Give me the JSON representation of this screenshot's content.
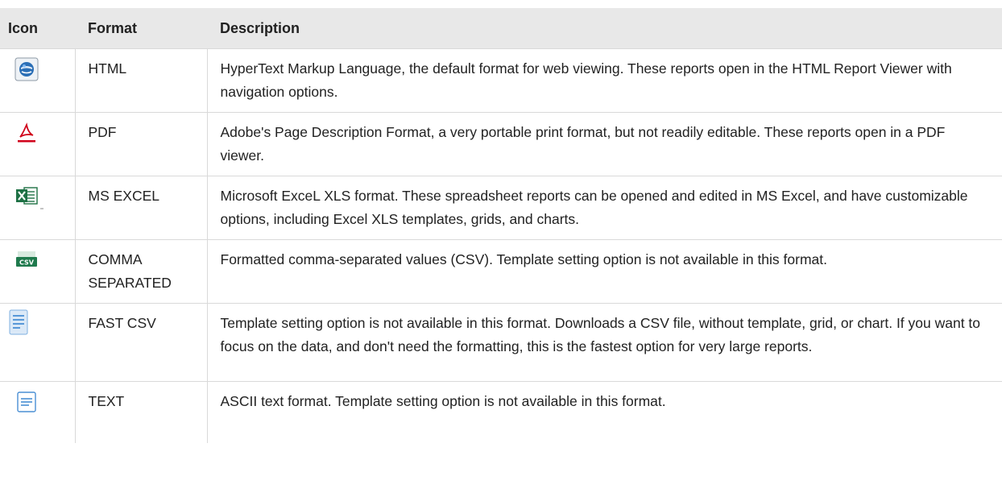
{
  "table": {
    "headers": {
      "icon": "Icon",
      "format": "Format",
      "description": "Description"
    },
    "rows": [
      {
        "icon": "html-globe-icon",
        "format": "HTML",
        "description": "HyperText Markup Language, the default format for web viewing. These reports open in the HTML Report Viewer with navigation options."
      },
      {
        "icon": "pdf-icon",
        "format": "PDF",
        "description": "Adobe's Page Description Format, a very portable print format, but not readily editable. These reports open in a PDF viewer."
      },
      {
        "icon": "excel-icon",
        "format": "MS EXCEL",
        "description": "Microsoft ExceL XLS format. These spreadsheet reports can be opened and edited in MS Excel, and have customizable options, including Excel XLS templates, grids, and charts."
      },
      {
        "icon": "csv-icon",
        "format": "COMMA SEPARATED",
        "description": "Formatted comma-separated values (CSV). Template setting option is not available in this format."
      },
      {
        "icon": "fast-csv-document-icon",
        "format": "FAST CSV",
        "description": "Template setting option is not available in this format. Downloads a CSV file, without template, grid, or chart. If you want to focus on the data, and don't need the formatting, this is the fastest option for very large reports."
      },
      {
        "icon": "text-document-icon",
        "format": "TEXT",
        "description": "ASCII text format. Template setting option is not available in this format."
      }
    ],
    "icon_labels": {
      "csv": "CSV"
    }
  },
  "colors": {
    "header_bg": "#e8e8e8",
    "row_border": "#d9d9d9",
    "pdf_red": "#d0021b",
    "excel_green": "#1e7145",
    "csv_green": "#1f7a4d",
    "html_blue": "#2b6fb6",
    "doc_blue": "#4a8fd4"
  }
}
